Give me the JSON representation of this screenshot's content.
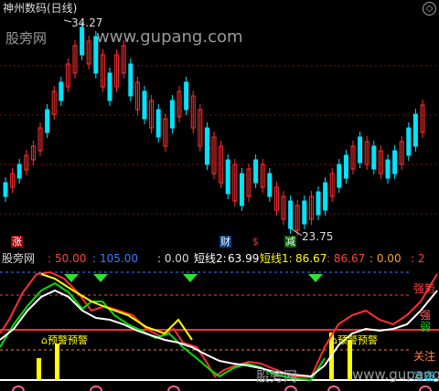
{
  "window": {
    "title": "神州数码(日线)"
  },
  "watermark": {
    "left": "股旁网",
    "center": "www.gupang.com"
  },
  "price_panel": {
    "high_label": "34.27",
    "low_label": "23.75",
    "markers": {
      "zhang": "涨",
      "cai": "财",
      "jian": "减",
      "yuan": "$"
    }
  },
  "indicator": {
    "name": "股旁网",
    "v1": "50.00",
    "v2": "105.00",
    "v3": ": 0.00",
    "short2_label": "短线2:",
    "short2_value": "63.99",
    "short1_label": "短线1:",
    "short1_value": "86.67",
    "v4": ": 86.67",
    "v5": ": 0.00",
    "v6": ": 2",
    "zone_labels": [
      "强势",
      "强",
      "弱",
      "关注",
      "准备"
    ],
    "alert_text": "预警",
    "colors": {
      "up": "#ff3030",
      "down": "#00e5ff",
      "yellow": "#ffff00",
      "green": "#00e000",
      "white": "#ffffff"
    }
  }
}
